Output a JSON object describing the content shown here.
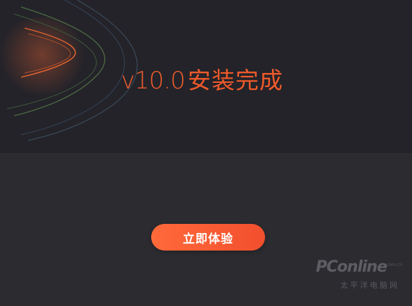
{
  "installer": {
    "version": "v10.0",
    "status_text": "安装完成",
    "start_button_label": "立即体验"
  },
  "watermark": {
    "logo": "PConline",
    "domain": ".com.cn",
    "subtitle": "太平洋电脑网"
  },
  "colors": {
    "accent": "#ef5a2a",
    "button_gradient_start": "#ff6a3a",
    "button_gradient_end": "#f24f2e",
    "hero_background": "#242329",
    "body_background": "#2b2b30"
  },
  "icons": {
    "hero_decoration": "swoosh-arcs-graphic"
  }
}
